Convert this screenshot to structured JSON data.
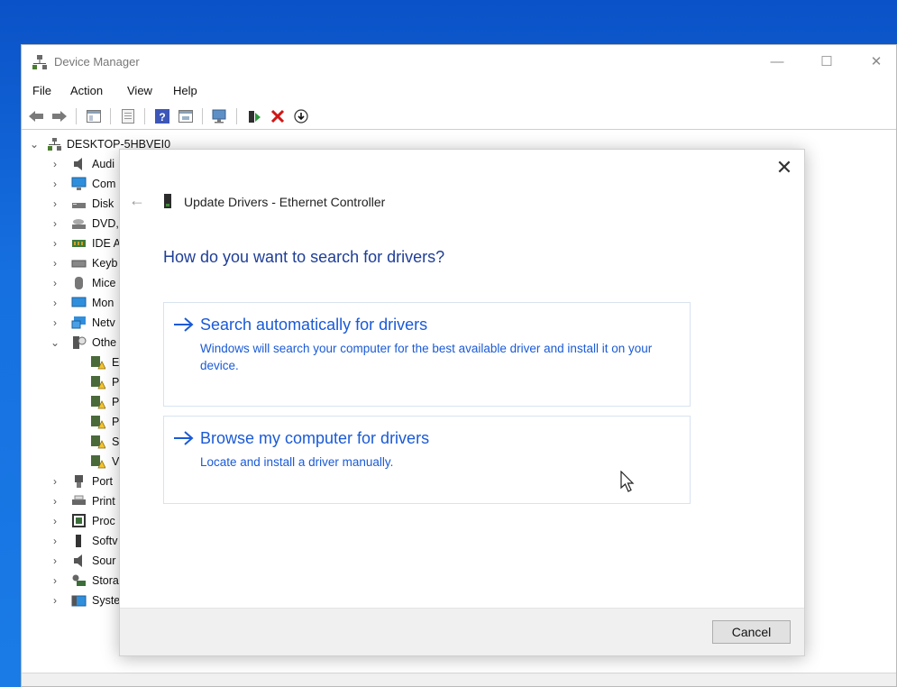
{
  "window": {
    "title": "Device Manager",
    "controls": {
      "minimize": "—",
      "maximize": "☐",
      "close": "✕"
    }
  },
  "menu": [
    "File",
    "Action",
    "View",
    "Help"
  ],
  "tree": {
    "root": "DESKTOP-5HBVEI0",
    "items": [
      {
        "label": "Audi",
        "icon": "speaker-icon",
        "expanded": false
      },
      {
        "label": "Com",
        "icon": "monitor-icon",
        "expanded": false
      },
      {
        "label": "Disk",
        "icon": "disk-icon",
        "expanded": false
      },
      {
        "label": "DVD,",
        "icon": "dvd-icon",
        "expanded": false
      },
      {
        "label": "IDE A",
        "icon": "ide-icon",
        "expanded": false
      },
      {
        "label": "Keyb",
        "icon": "keyboard-icon",
        "expanded": false
      },
      {
        "label": "Mice",
        "icon": "mouse-icon",
        "expanded": false
      },
      {
        "label": "Mon",
        "icon": "monitor-icon",
        "expanded": false
      },
      {
        "label": "Netv",
        "icon": "network-icon",
        "expanded": false
      },
      {
        "label": "Othe",
        "icon": "other-devices-icon",
        "expanded": true
      },
      {
        "label": "E",
        "icon": "warning-device-icon",
        "child": true
      },
      {
        "label": "P",
        "icon": "warning-device-icon",
        "child": true
      },
      {
        "label": "P",
        "icon": "warning-device-icon",
        "child": true
      },
      {
        "label": "P",
        "icon": "warning-device-icon",
        "child": true
      },
      {
        "label": "S",
        "icon": "warning-device-icon",
        "child": true
      },
      {
        "label": "V",
        "icon": "warning-device-icon",
        "child": true
      },
      {
        "label": "Port",
        "icon": "port-icon",
        "expanded": false
      },
      {
        "label": "Print",
        "icon": "printer-icon",
        "expanded": false
      },
      {
        "label": "Proc",
        "icon": "processor-icon",
        "expanded": false
      },
      {
        "label": "Softv",
        "icon": "software-icon",
        "expanded": false
      },
      {
        "label": "Sour",
        "icon": "speaker-icon",
        "expanded": false
      },
      {
        "label": "Stora",
        "icon": "storage-icon",
        "expanded": false
      },
      {
        "label": "Syste",
        "icon": "system-icon",
        "expanded": false
      }
    ]
  },
  "dialog": {
    "title": "Update Drivers - Ethernet Controller",
    "heading": "How do you want to search for drivers?",
    "options": [
      {
        "title": "Search automatically for drivers",
        "description": "Windows will search your computer for the best available driver and install it on your device."
      },
      {
        "title": "Browse my computer for drivers",
        "description": "Locate and install a driver manually."
      }
    ],
    "cancel_label": "Cancel",
    "close_glyph": "✕",
    "back_glyph": "←"
  },
  "colors": {
    "accent": "#1a5ad7",
    "heading": "#1f3e97",
    "desktop": "#0a64d8"
  }
}
